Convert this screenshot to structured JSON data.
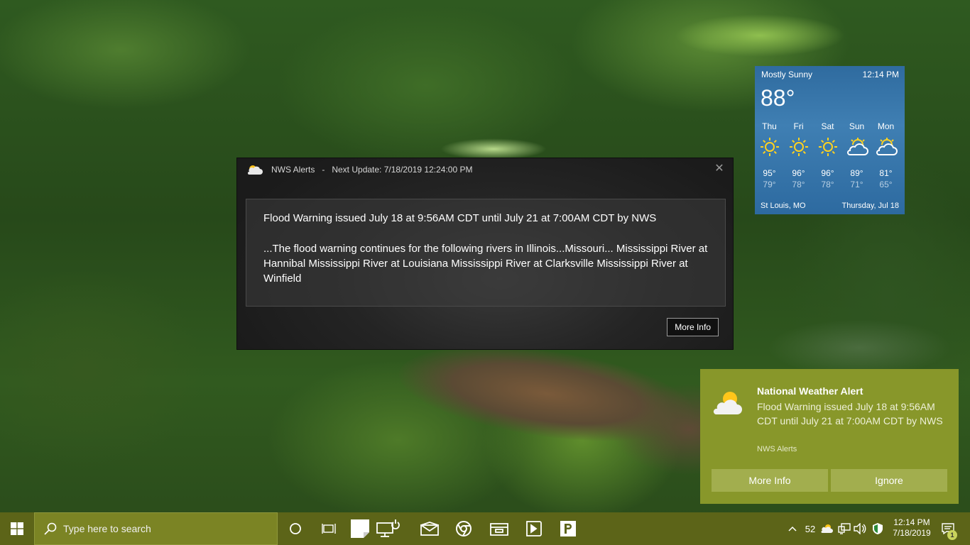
{
  "weather": {
    "condition": "Mostly Sunny",
    "time": "12:14 PM",
    "temp": "88°",
    "days": [
      {
        "name": "Thu",
        "icon": "sun-icon",
        "high": "95°",
        "low": "79°"
      },
      {
        "name": "Fri",
        "icon": "sun-icon",
        "high": "96°",
        "low": "78°"
      },
      {
        "name": "Sat",
        "icon": "sun-icon",
        "high": "96°",
        "low": "78°"
      },
      {
        "name": "Sun",
        "icon": "partly-cloudy-icon",
        "high": "89°",
        "low": "71°"
      },
      {
        "name": "Mon",
        "icon": "partly-cloudy-icon",
        "high": "81°",
        "low": "65°"
      }
    ],
    "city": "St Louis, MO",
    "date": "Thursday, Jul 18"
  },
  "alert_window": {
    "app_name": "NWS Alerts",
    "separator": "-",
    "next_update": "Next Update: 7/18/2019 12:24:00 PM",
    "close_label": "✕",
    "headline": "Flood Warning issued July 18 at 9:56AM CDT until July 21 at 7:00AM CDT by NWS",
    "description": "...The flood warning continues for the following rivers in Illinois...Missouri... Mississippi River at Hannibal Mississippi River at Louisiana Mississippi River at Clarksville Mississippi River at Winfield",
    "more_info": "More Info"
  },
  "toast": {
    "title": "National Weather Alert",
    "text": "Flood Warning issued July 18 at 9:56AM CDT until July 21 at 7:00AM CDT by NWS",
    "source": "NWS Alerts",
    "button_more": "More Info",
    "button_ignore": "Ignore"
  },
  "taskbar": {
    "search_placeholder": "Type here to search",
    "temperature": "52",
    "clock_time": "12:14 PM",
    "clock_date": "7/18/2019",
    "notification_count": "1",
    "colors": {
      "taskbar": "#5c6418",
      "search": "#7b8424",
      "toast": "#88972a"
    }
  }
}
